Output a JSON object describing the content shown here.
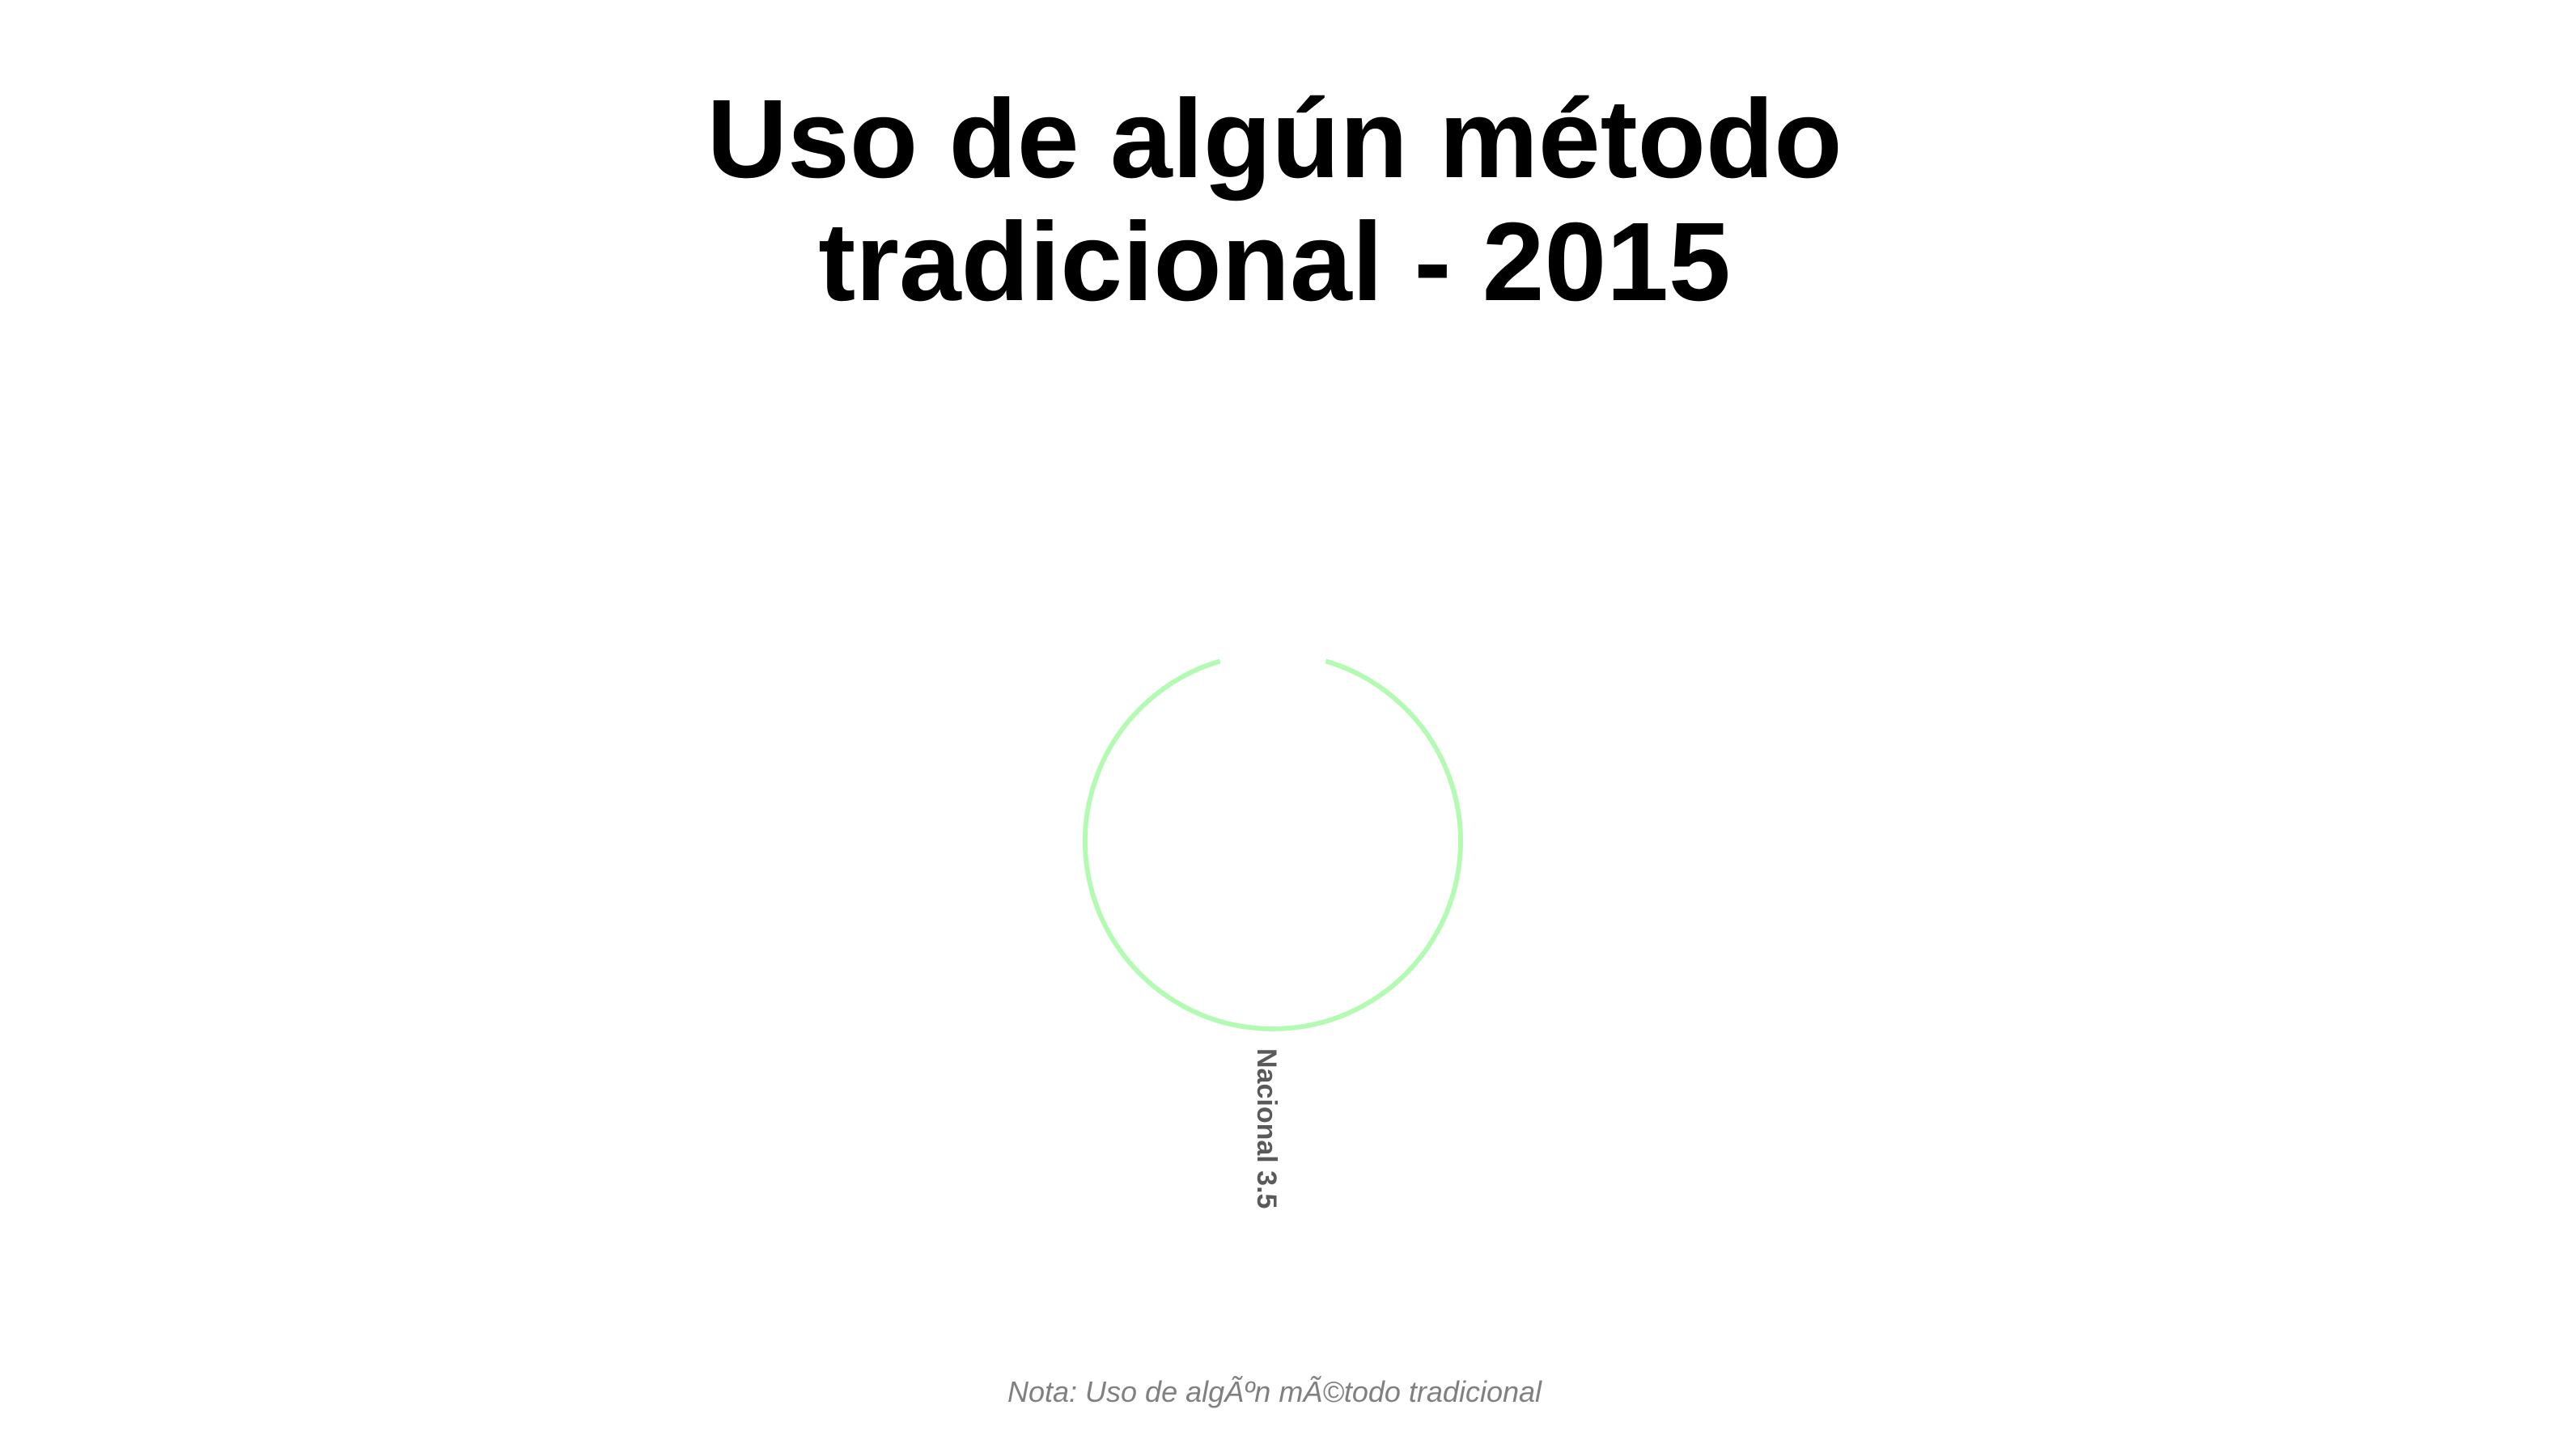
{
  "chart_data": {
    "type": "bar",
    "coordinate_system": "polar",
    "title": "Uso de algún método\ntradicional - 2015",
    "categories": [
      "Nacional"
    ],
    "values": [
      3.5
    ],
    "bar_labels": [
      "Nacional 3.5"
    ],
    "caption": "Nota: Uso de algÃºn mÃ©todo tradicional",
    "colors": {
      "bar": "#B3FBB3",
      "label": "#5A5A5A",
      "caption": "#808080",
      "title": "#000000"
    },
    "legend": "none",
    "grid": false
  }
}
